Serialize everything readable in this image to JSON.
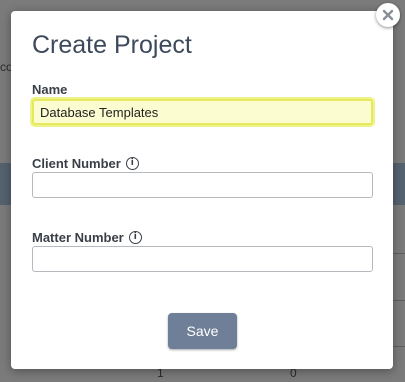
{
  "background": {
    "partial_text": "co",
    "row_values": [
      "1",
      "0"
    ]
  },
  "modal": {
    "title": "Create Project",
    "close_icon": "close-icon",
    "fields": {
      "name": {
        "label": "Name",
        "value": "Database Templates"
      },
      "client_number": {
        "label": "Client Number",
        "value": "",
        "info_icon": "info-icon"
      },
      "matter_number": {
        "label": "Matter Number",
        "value": "",
        "info_icon": "info-icon"
      }
    },
    "save_label": "Save"
  },
  "colors": {
    "title": "#3d4a5c",
    "save_button": "#6f7f98",
    "focus_highlight": "#e6ea5a",
    "background_band": "#556270"
  }
}
